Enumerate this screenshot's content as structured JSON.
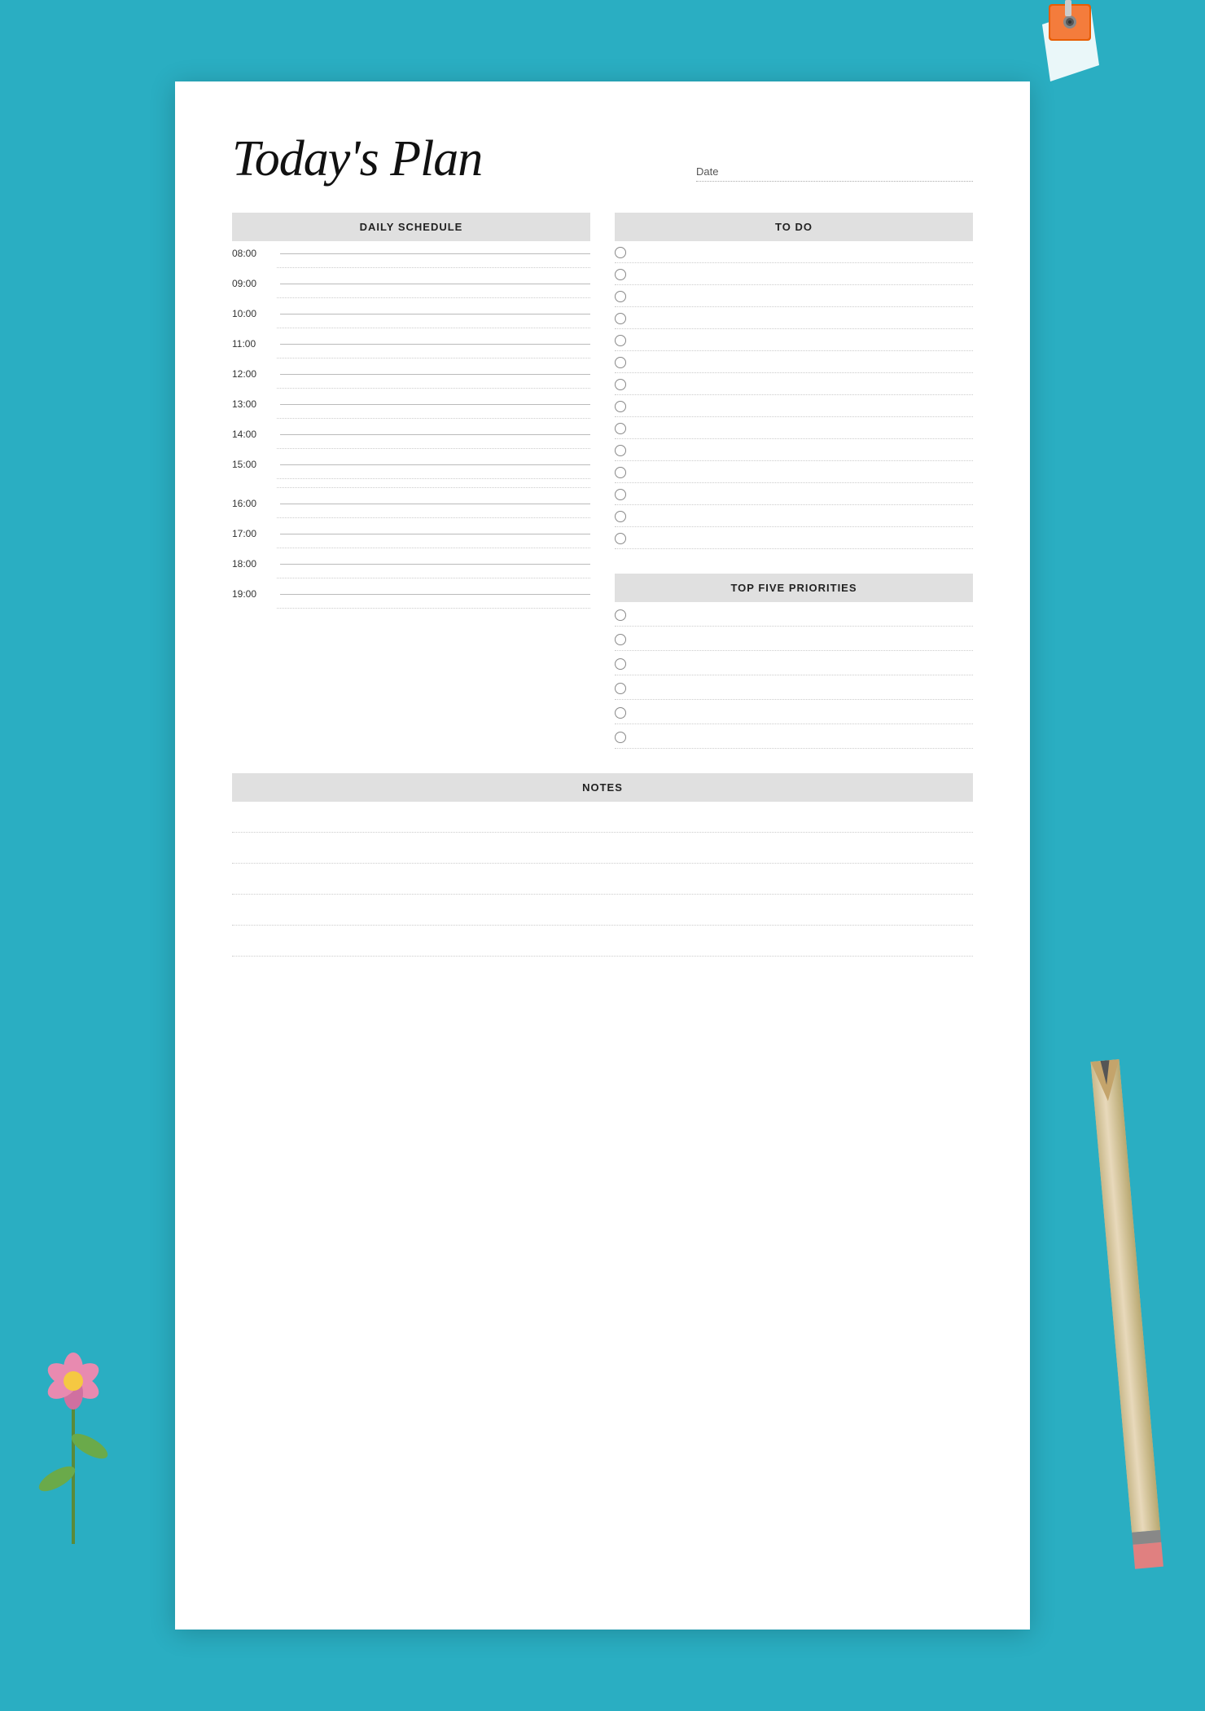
{
  "page": {
    "title": "Today's Plan",
    "date_label": "Date",
    "background_color": "#2aaec2",
    "paper_color": "#ffffff"
  },
  "daily_schedule": {
    "header": "DAILY SCHEDULE",
    "times": [
      "08:00",
      "09:00",
      "10:00",
      "11:00",
      "12:00",
      "13:00",
      "14:00",
      "15:00",
      "16:00",
      "17:00",
      "18:00",
      "19:00"
    ]
  },
  "todo": {
    "header": "TO DO",
    "items_count": 14
  },
  "top_five_priorities": {
    "header": "TOP FIVE PRIORITIES",
    "items_count": 6
  },
  "notes": {
    "header": "NOTES",
    "lines_count": 5
  }
}
